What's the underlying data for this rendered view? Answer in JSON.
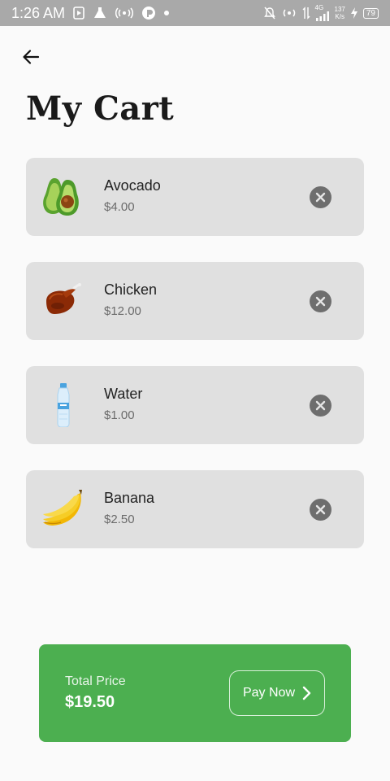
{
  "status_bar": {
    "time": "1:26 AM",
    "network_type": "4G",
    "speed_value": "137",
    "speed_unit": "K/s",
    "battery": "79"
  },
  "header": {
    "back_icon": "arrow-left-icon",
    "title": "My Cart"
  },
  "cart": {
    "items": [
      {
        "name": "Avocado",
        "price": "$4.00",
        "icon": "avocado-icon"
      },
      {
        "name": "Chicken",
        "price": "$12.00",
        "icon": "roast-chicken-icon"
      },
      {
        "name": "Water",
        "price": "$1.00",
        "icon": "water-bottle-icon"
      },
      {
        "name": "Banana",
        "price": "$2.50",
        "icon": "banana-icon"
      }
    ],
    "remove_icon": "close-circle-icon"
  },
  "checkout": {
    "total_label": "Total Price",
    "total_value": "$19.50",
    "pay_label": "Pay Now",
    "pay_icon": "chevron-right-icon"
  },
  "colors": {
    "accent": "#4caf50",
    "card_bg": "#e0e0e0",
    "status_bar_bg": "#a9a9a9",
    "remove_button": "#6e6e6e"
  }
}
